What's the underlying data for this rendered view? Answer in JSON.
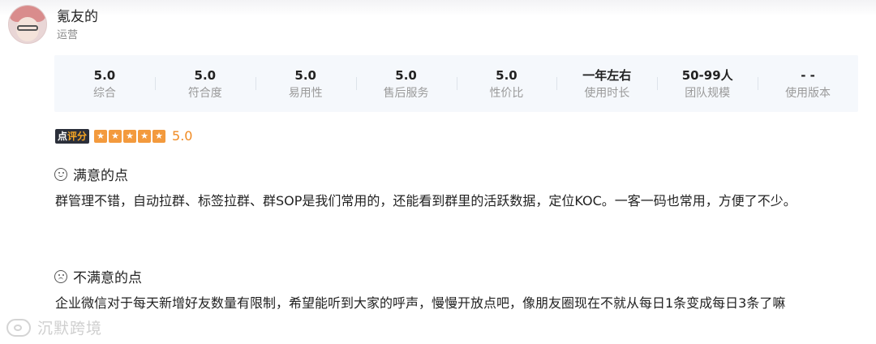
{
  "user": {
    "name": "氪友的",
    "role": "运营"
  },
  "stats": [
    {
      "value": "5.0",
      "label": "综合"
    },
    {
      "value": "5.0",
      "label": "符合度"
    },
    {
      "value": "5.0",
      "label": "易用性"
    },
    {
      "value": "5.0",
      "label": "售后服务"
    },
    {
      "value": "5.0",
      "label": "性价比"
    },
    {
      "value": "一年左右",
      "label": "使用时长"
    },
    {
      "value": "50-99人",
      "label": "团队规模"
    },
    {
      "value": "- -",
      "label": "使用版本"
    }
  ],
  "rating": {
    "badge_prefix": "点",
    "badge_accent": "评分",
    "stars": 5,
    "value": "5.0",
    "star_color": "#f39a3d"
  },
  "satisfied": {
    "title": "满意的点",
    "icon": "smile-icon",
    "text": "群管理不错，自动拉群、标签拉群、群SOP是我们常用的，还能看到群里的活跃数据，定位KOC。一客一码也常用，方便了不少。"
  },
  "unsatisfied": {
    "title": "不满意的点",
    "icon": "frown-icon",
    "text": "企业微信对于每天新增好友数量有限制，希望能听到大家的呼声，慢慢开放点吧，像朋友圈现在不就从每日1条变成每日3条了嘛"
  },
  "watermark": {
    "text": "沉默跨境"
  }
}
